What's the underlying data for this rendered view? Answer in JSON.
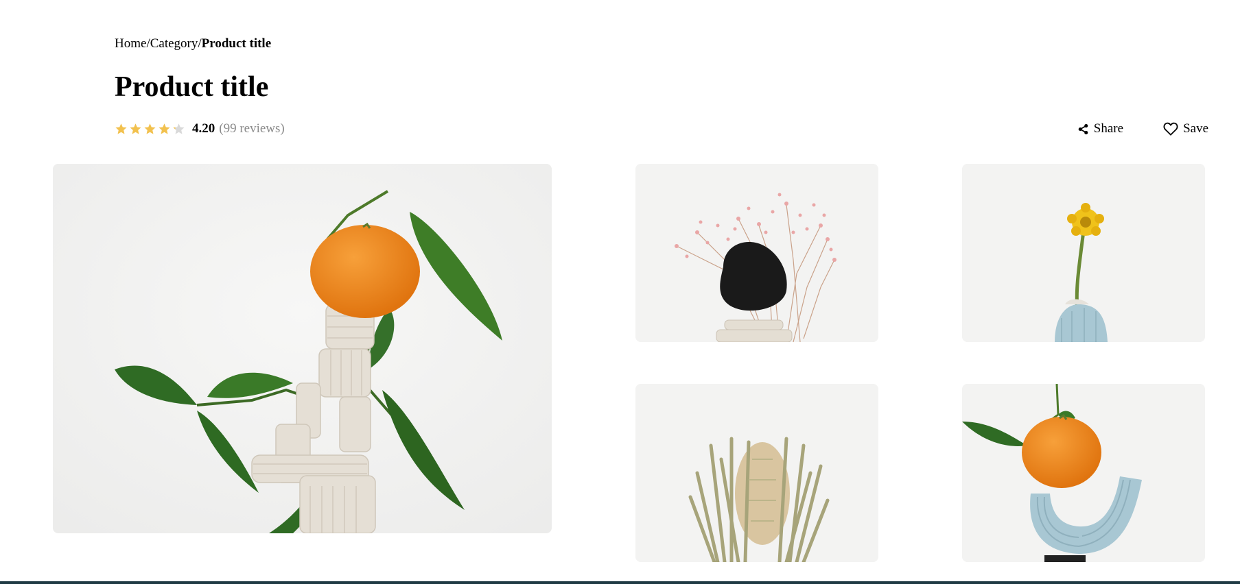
{
  "breadcrumb": {
    "home": "Home",
    "separator1": "/",
    "category": "Category",
    "separator2": "/",
    "current": "Product title"
  },
  "product": {
    "title": "Product title",
    "rating": 4.2,
    "rating_label": "4.20",
    "reviews_label": "(99 reviews)",
    "star_count": 5,
    "star_color": "#f2c14e",
    "star_empty_color": "#d9d9d9"
  },
  "actions": {
    "share_label": "Share",
    "share_icon": "share-icon",
    "save_label": "Save",
    "save_icon": "heart-icon"
  },
  "gallery": {
    "images": [
      {
        "name": "main-product-image",
        "subject": "orange on clay sculpture with leaves"
      },
      {
        "name": "thumbnail-pink-flowers",
        "subject": "pink dried flowers with black stone"
      },
      {
        "name": "thumbnail-yellow-flower",
        "subject": "yellow flower in blue vase"
      },
      {
        "name": "thumbnail-dried-protea",
        "subject": "dried banksia flower"
      },
      {
        "name": "thumbnail-orange-blue-vase",
        "subject": "orange on blue clay sculpture"
      }
    ]
  },
  "colors": {
    "accent_bar": "#1f3a44",
    "image_bg": "#f2f2f2",
    "orange": "#f08a1c",
    "leaf": "#2f6b24",
    "clay": "#e6e1d8",
    "blue_clay": "#a8c7d3"
  }
}
